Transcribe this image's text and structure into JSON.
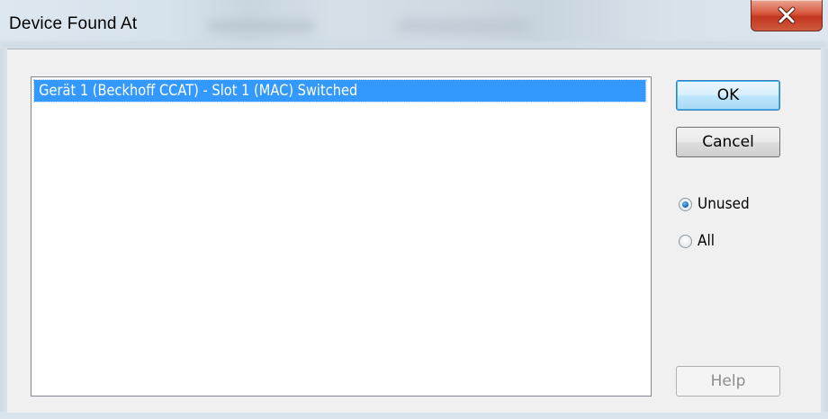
{
  "window": {
    "title": "Device Found At",
    "close_label": "X"
  },
  "list": {
    "items": [
      "Gerät 1 (Beckhoff CCAT) - Slot 1 (MAC) Switched"
    ],
    "selected_index": 0
  },
  "buttons": {
    "ok": "OK",
    "cancel": "Cancel",
    "help": "Help"
  },
  "filter": {
    "options": [
      "Unused",
      "All"
    ],
    "selected": "Unused"
  },
  "colors": {
    "selection": "#3399ff",
    "close_button": "#c9402a"
  },
  "icons": {
    "close": "close-icon"
  }
}
